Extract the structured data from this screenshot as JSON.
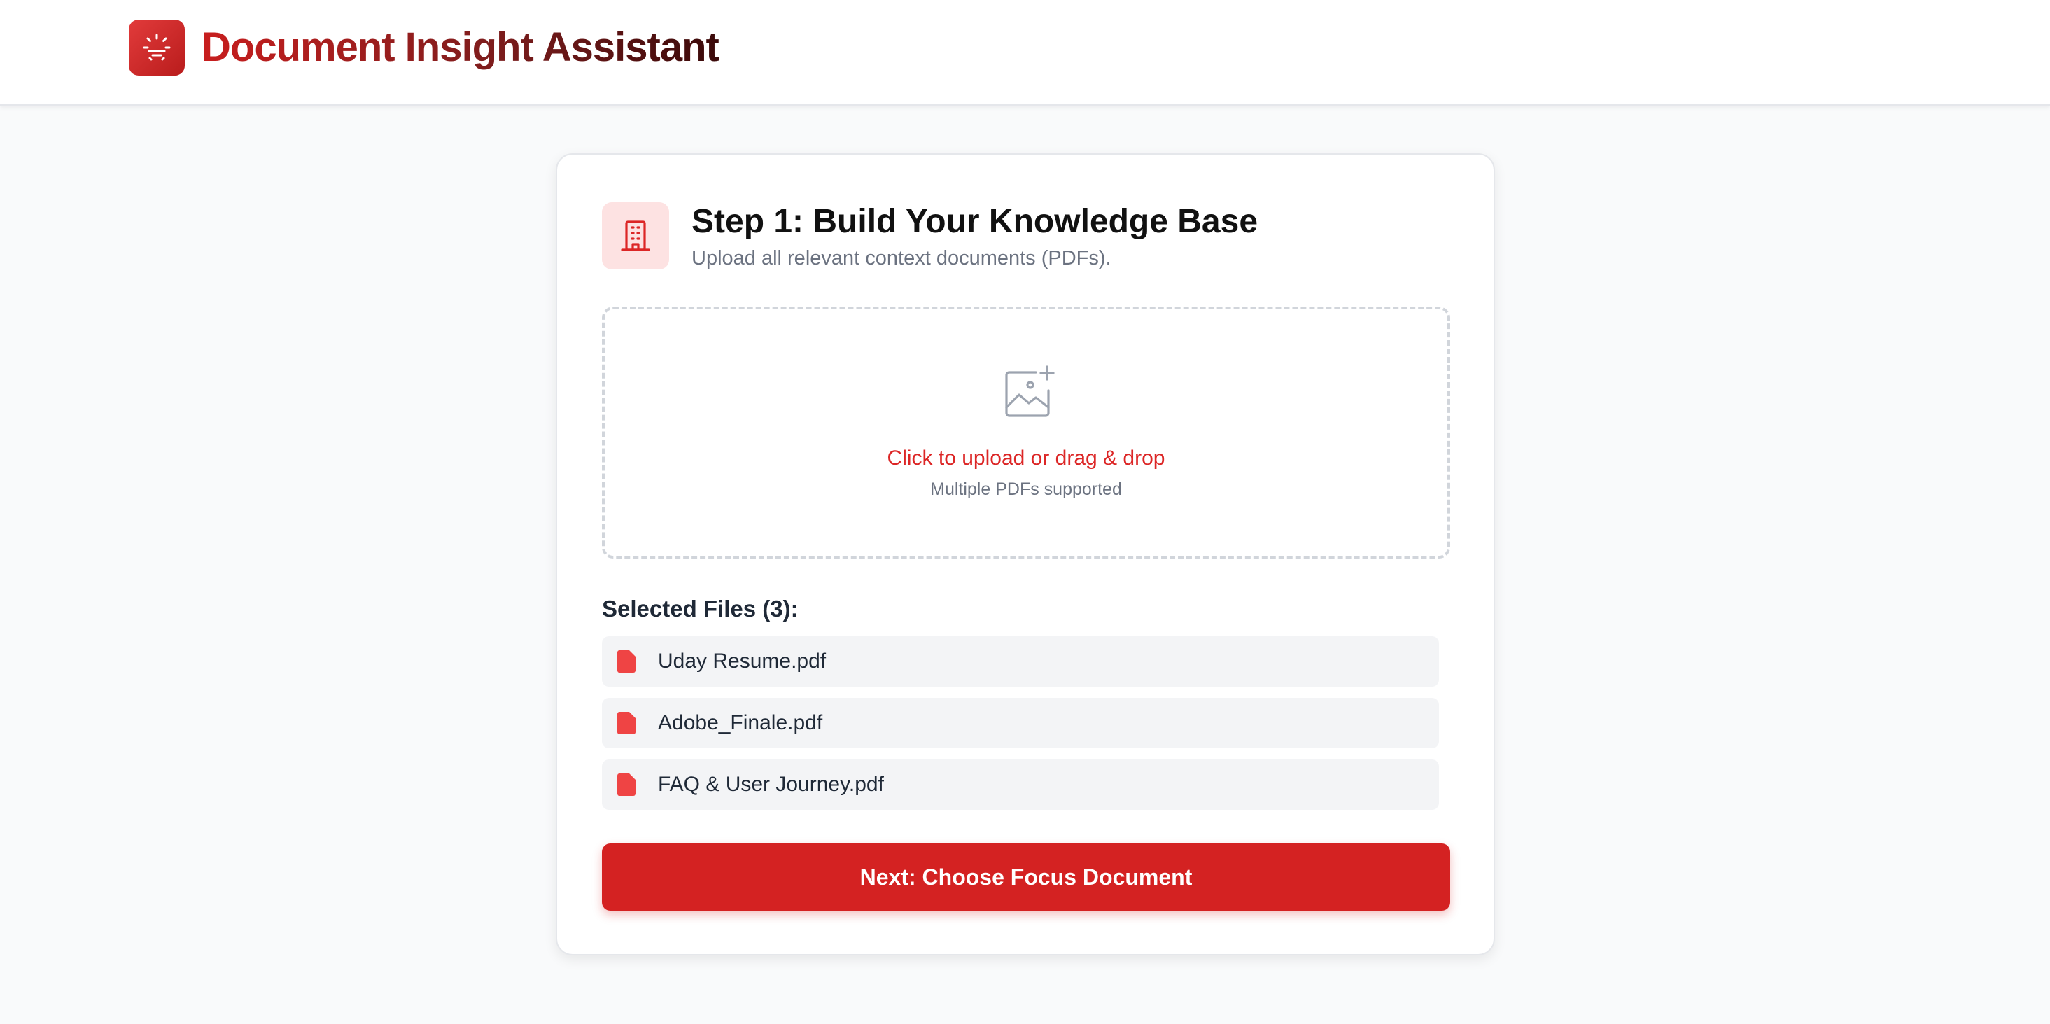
{
  "header": {
    "logo_icon": "sparkle-lamp-icon",
    "title": "Document Insight Assistant",
    "brand_color": "#d42222"
  },
  "step": {
    "icon": "building-icon",
    "title": "Step 1: Build Your Knowledge Base",
    "subtitle": "Upload all relevant context documents (PDFs)."
  },
  "dropzone": {
    "icon": "image-add-icon",
    "main_text": "Click to upload or drag & drop",
    "sub_text": "Multiple PDFs supported"
  },
  "files": {
    "heading": "Selected Files (3):",
    "items": [
      {
        "name": "Uday Resume.pdf",
        "icon": "pdf-file-icon"
      },
      {
        "name": "Adobe_Finale.pdf",
        "icon": "pdf-file-icon"
      },
      {
        "name": "FAQ & User Journey.pdf",
        "icon": "pdf-file-icon"
      }
    ]
  },
  "actions": {
    "next_label": "Next: Choose Focus Document"
  }
}
